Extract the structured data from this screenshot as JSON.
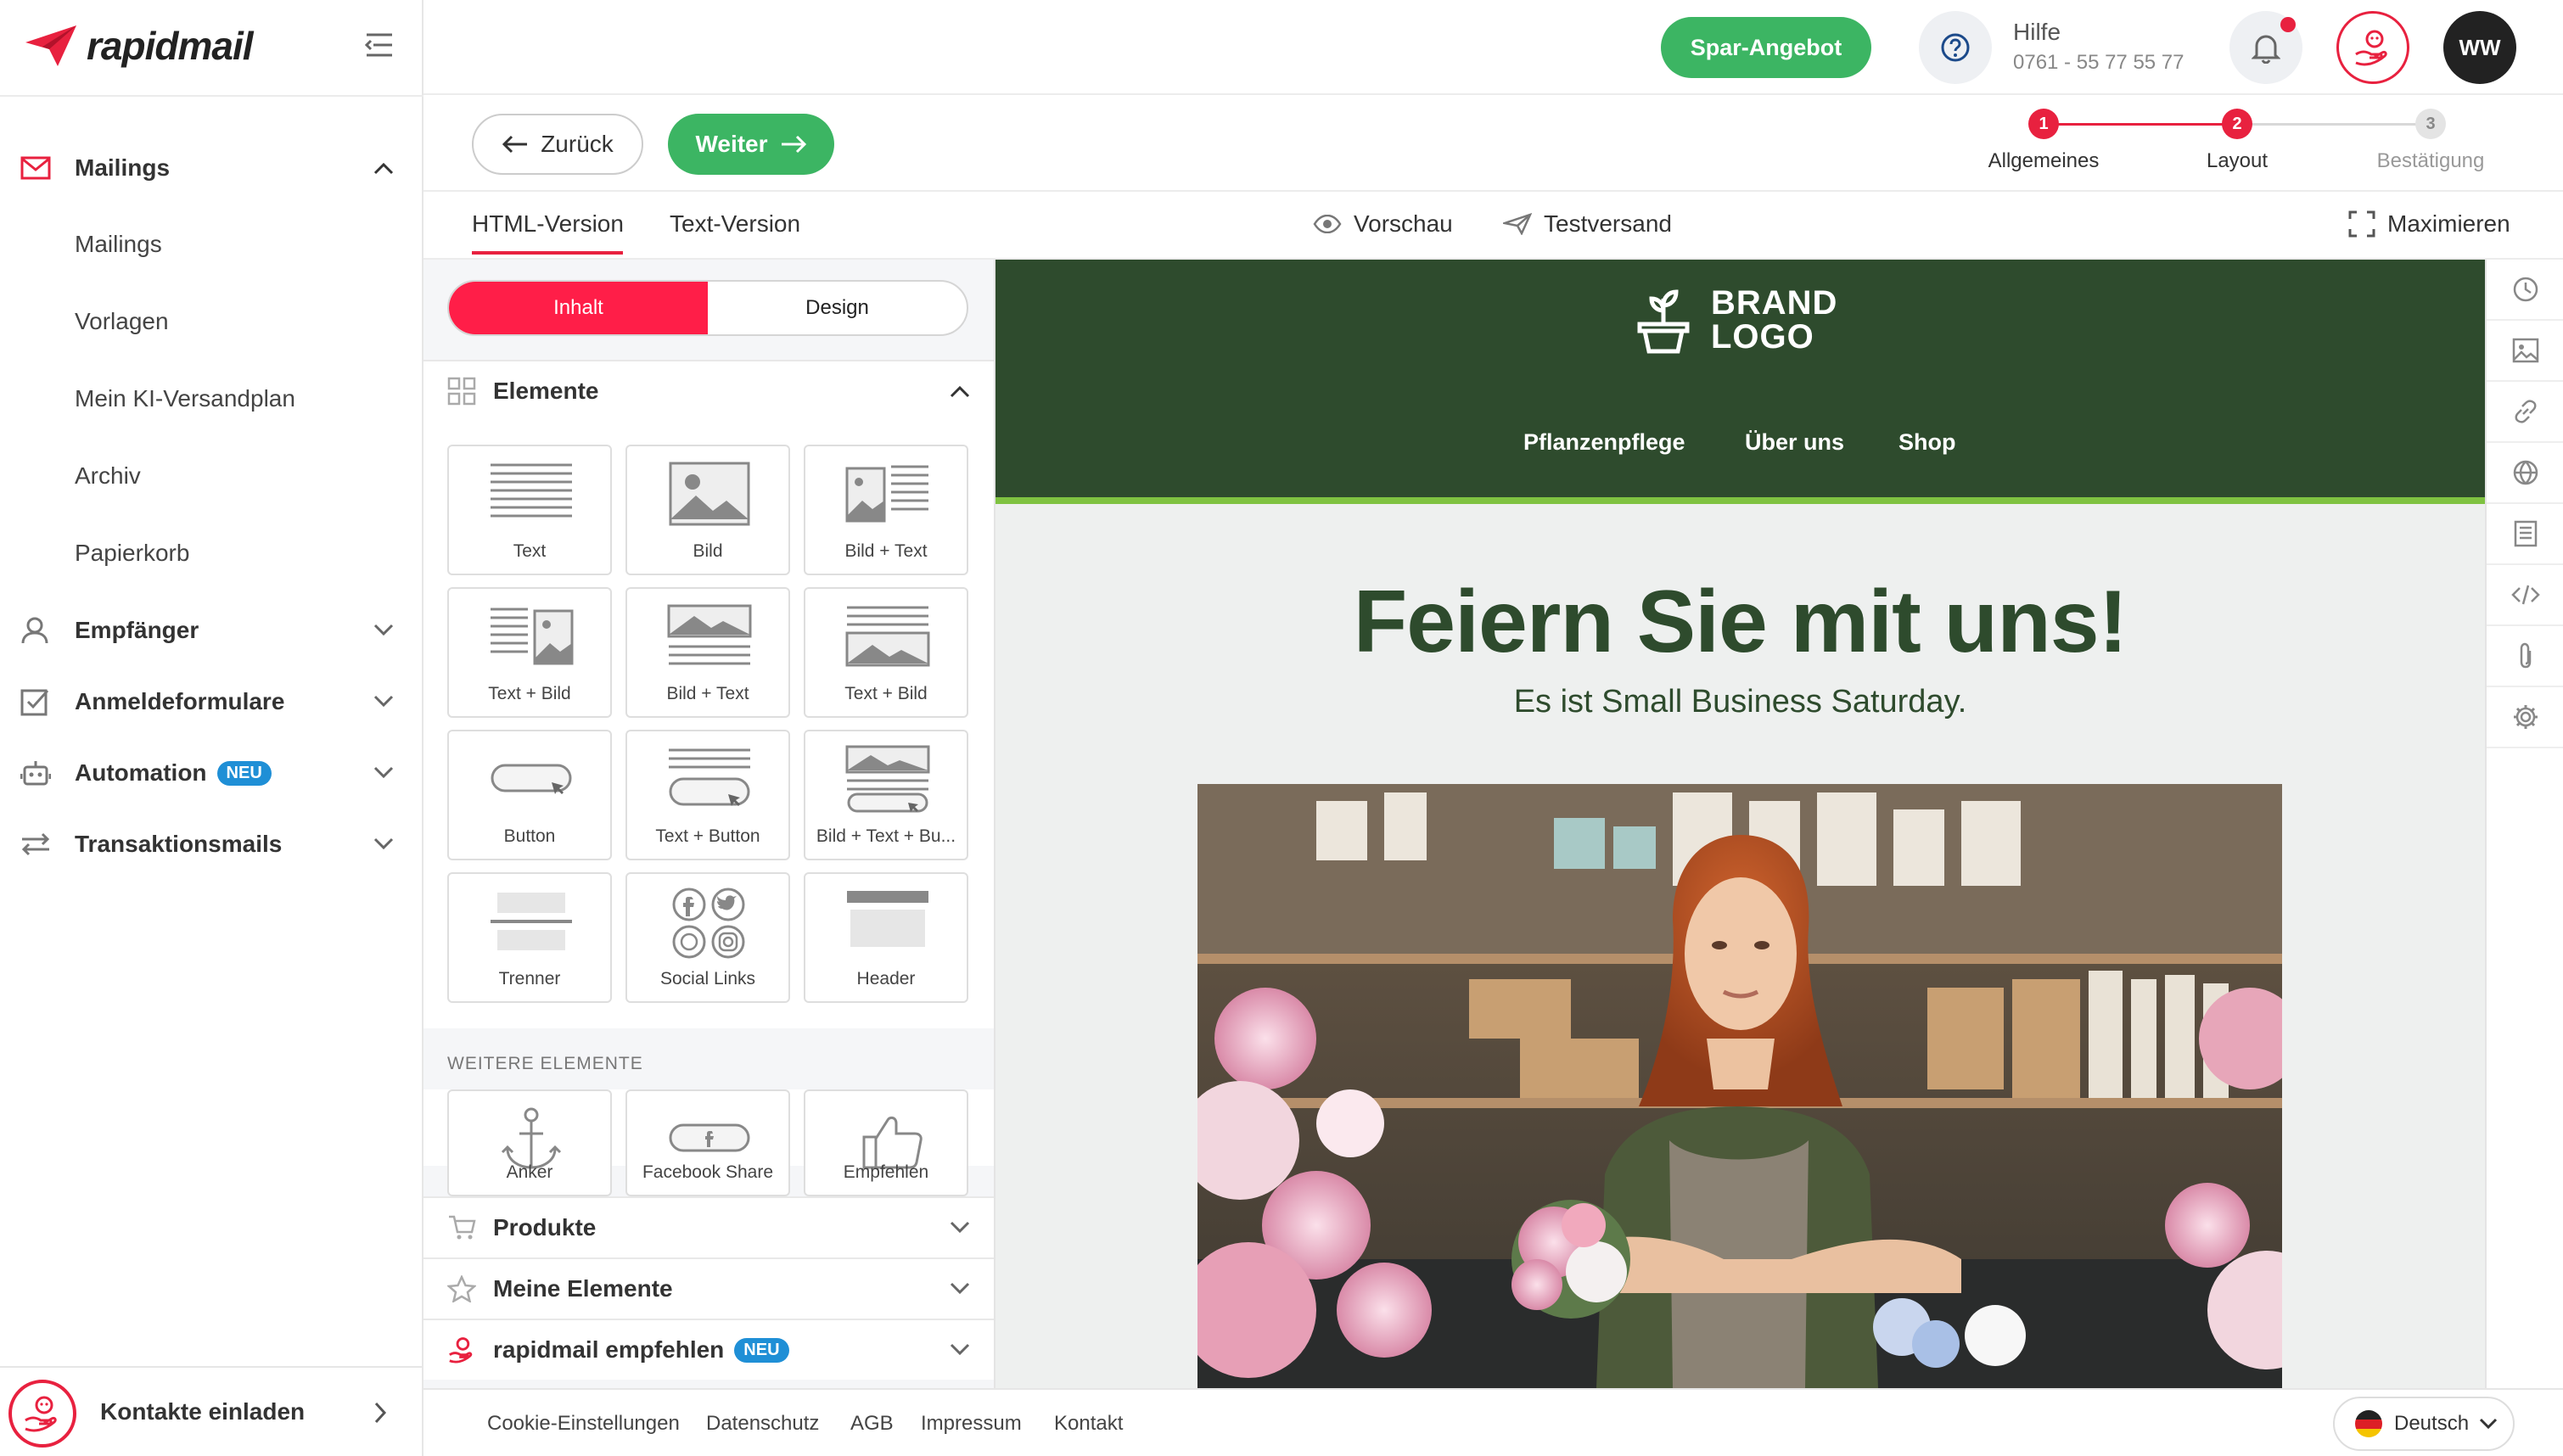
{
  "app": {
    "brand": "rapidmail"
  },
  "sidebar": {
    "items": [
      {
        "label": "Mailings",
        "expanded": true
      },
      {
        "label": "Empfänger"
      },
      {
        "label": "Anmeldeformulare"
      },
      {
        "label": "Automation",
        "badge": "NEU"
      },
      {
        "label": "Transaktionsmails"
      }
    ],
    "subitems": [
      "Mailings",
      "Vorlagen",
      "Mein KI-Versandplan",
      "Archiv",
      "Papierkorb"
    ],
    "invite_label": "Kontakte einladen"
  },
  "topbar": {
    "promo": "Spar-Angebot",
    "help_label": "Hilfe",
    "help_phone": "0761 - 55 77 55 77",
    "avatar": "WW"
  },
  "actions": {
    "back": "Zurück",
    "next": "Weiter",
    "steps": [
      {
        "num": "1",
        "label": "Allgemeines",
        "state": "done"
      },
      {
        "num": "2",
        "label": "Layout",
        "state": "active"
      },
      {
        "num": "3",
        "label": "Bestätigung",
        "state": "pending"
      }
    ]
  },
  "tabs": {
    "html": "HTML-Version",
    "text": "Text-Version",
    "preview": "Vorschau",
    "test": "Testversand",
    "maximize": "Maximieren"
  },
  "panel": {
    "segment": {
      "content": "Inhalt",
      "design": "Design"
    },
    "elements_title": "Elemente",
    "tiles": [
      "Text",
      "Bild",
      "Bild + Text",
      "Text + Bild",
      "Bild + Text",
      "Text + Bild",
      "Button",
      "Text + Button",
      "Bild + Text + Bu...",
      "Trenner",
      "Social Links",
      "Header"
    ],
    "more_title": "WEITERE ELEMENTE",
    "more_tiles": [
      "Anker",
      "Facebook Share",
      "Empfehlen"
    ],
    "sections": [
      {
        "label": "Produkte"
      },
      {
        "label": "Meine Elemente"
      },
      {
        "label": "rapidmail empfehlen",
        "badge": "NEU"
      }
    ]
  },
  "email": {
    "brand_line1": "BRAND",
    "brand_line2": "LOGO",
    "nav": [
      "Pflanzenpflege",
      "Über uns",
      "Shop"
    ],
    "headline": "Feiern Sie mit uns!",
    "subline": "Es ist Small Business Saturday.",
    "colors": {
      "header": "#2e4b2d",
      "stripe": "#7fc241",
      "accent": "#e8213f",
      "green_button": "#3cb563"
    }
  },
  "footer": {
    "links": [
      "Cookie-Einstellungen",
      "Datenschutz",
      "AGB",
      "Impressum",
      "Kontakt"
    ],
    "language": "Deutsch"
  }
}
